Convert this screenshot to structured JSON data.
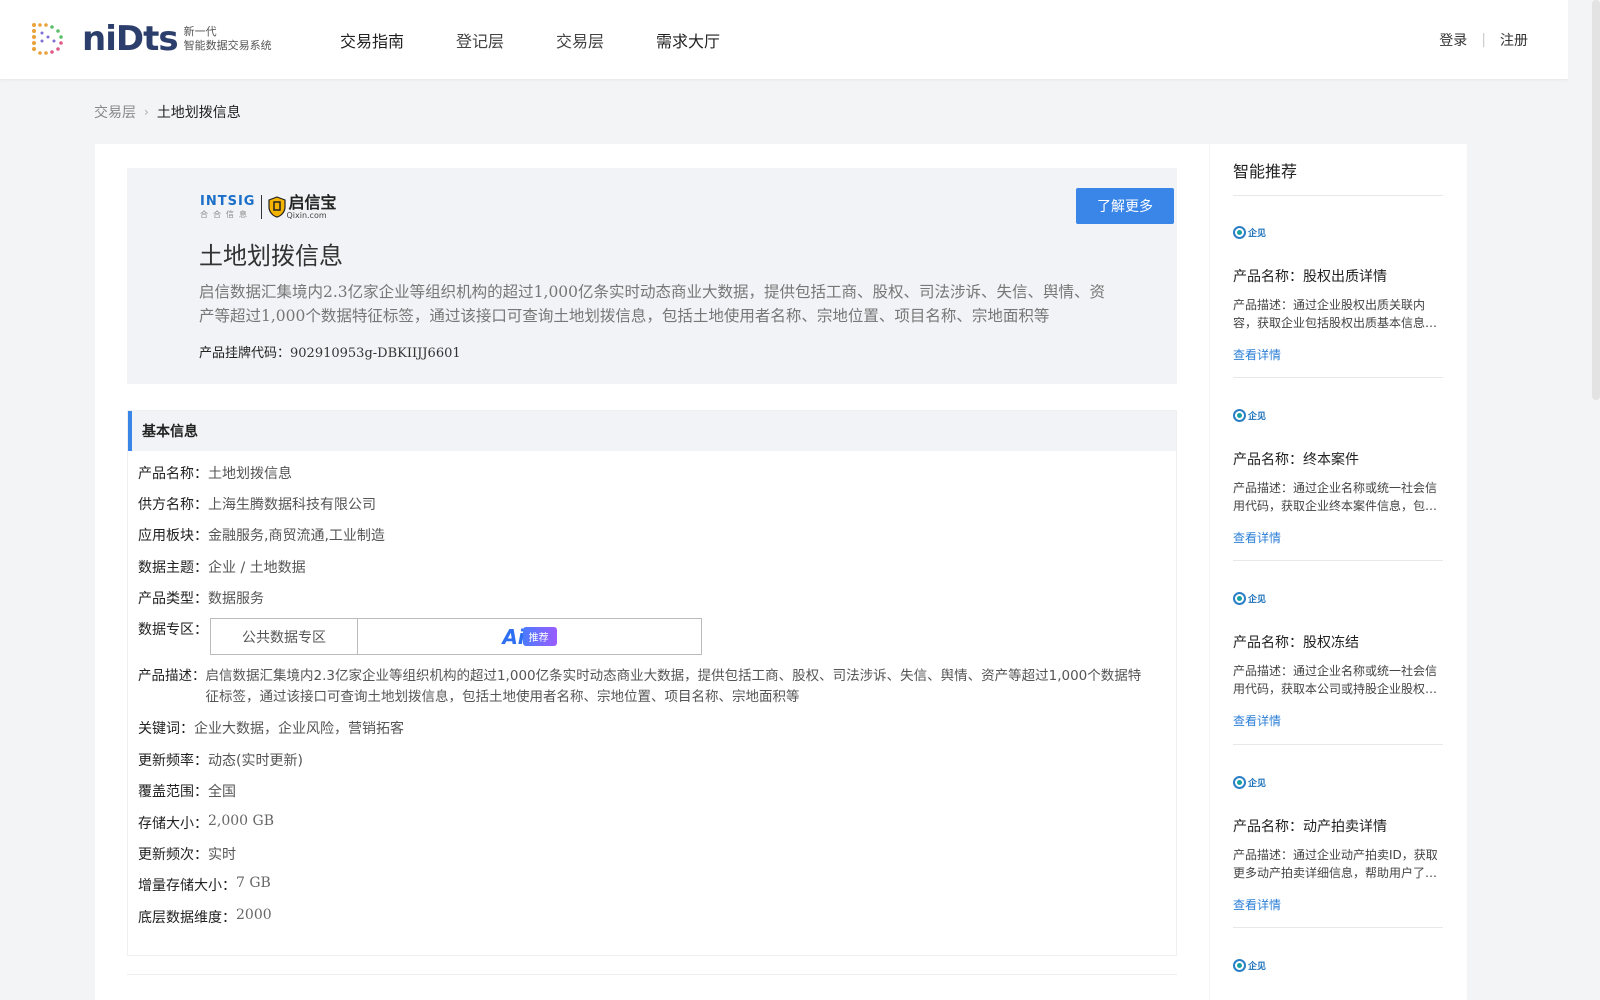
{
  "header": {
    "logo_word": "niDts",
    "logo_sub_line1": "新一代",
    "logo_sub_line2": "智能数据交易系统",
    "nav": [
      "交易指南",
      "登记层",
      "交易层",
      "需求大厅"
    ],
    "login": "登录",
    "register": "注册"
  },
  "breadcrumb": {
    "parent": "交易层",
    "current": "土地划拨信息"
  },
  "hero": {
    "brand_left": "INTSIG",
    "brand_left_sub": "合合信息",
    "brand_right": "启信宝",
    "brand_right_url": "Qixin.com",
    "title": "土地划拨信息",
    "description": "启信数据汇集境内2.3亿家企业等组织机构的超过1,000亿条实时动态商业大数据，提供包括工商、股权、司法涉诉、失信、舆情、资产等超过1,000个数据特征标签，通过该接口可查询土地划拨信息，包括土地使用者名称、宗地位置、项目名称、宗地面积等",
    "code_label": "产品挂牌代码：",
    "code_value": "902910953g-DBKIIJJ6601",
    "more_button": "了解更多"
  },
  "info": {
    "section_title": "基本信息",
    "product_name_label": "产品名称：",
    "product_name": "土地划拨信息",
    "supplier_label": "供方名称：",
    "supplier": "上海生腾数据科技有限公司",
    "sector_label": "应用板块：",
    "sector": "金融服务,商贸流通,工业制造",
    "topic_label": "数据主题：",
    "topic": "企业 / 土地数据",
    "type_label": "产品类型：",
    "type": "数据服务",
    "zone_label": "数据专区：",
    "zone_cell": "公共数据专区",
    "ai_mark": "Ai",
    "ai_tag": "推荐",
    "desc_label": "产品描述：",
    "desc": "启信数据汇集境内2.3亿家企业等组织机构的超过1,000亿条实时动态商业大数据，提供包括工商、股权、司法涉诉、失信、舆情、资产等超过1,000个数据特征标签，通过该接口可查询土地划拨信息，包括土地使用者名称、宗地位置、项目名称、宗地面积等",
    "keywords_label": "关键词：",
    "keywords": "企业大数据，企业风险，营销拓客",
    "update_freq_label": "更新频率：",
    "update_freq": "动态(实时更新)",
    "coverage_label": "覆盖范围：",
    "coverage": "全国",
    "storage_label": "存储大小：",
    "storage": "2,000 GB",
    "update_times_label": "更新频次：",
    "update_times": "实时",
    "incr_label": "增量存储大小：",
    "incr": "7 GB",
    "dims_label": "底层数据维度：",
    "dims": "2000"
  },
  "sidebar": {
    "title": "智能推荐",
    "logo_text": "企见",
    "link_label": "查看详情",
    "items": [
      {
        "name": "产品名称：股权出质详情",
        "desc": "产品描述：通过企业股权出质关联内容，获取企业包括股权出质基本信息、质权人等详细信息"
      },
      {
        "name": "产品名称：终本案件",
        "desc": "产品描述：通过企业名称或统一社会信用代码，获取企业终本案件信息，包括案号等"
      },
      {
        "name": "产品名称：股权冻结",
        "desc": "产品描述：通过企业名称或统一社会信用代码，获取本公司或持股企业股权冻结信息"
      },
      {
        "name": "产品名称：动产拍卖详情",
        "desc": "产品描述：通过企业动产拍卖ID，获取更多动产拍卖详细信息，帮助用户了解详情"
      }
    ]
  },
  "colors": {
    "accent": "#3a86e8",
    "link": "#2b7fd6",
    "page_bg": "#f3f4f6"
  }
}
